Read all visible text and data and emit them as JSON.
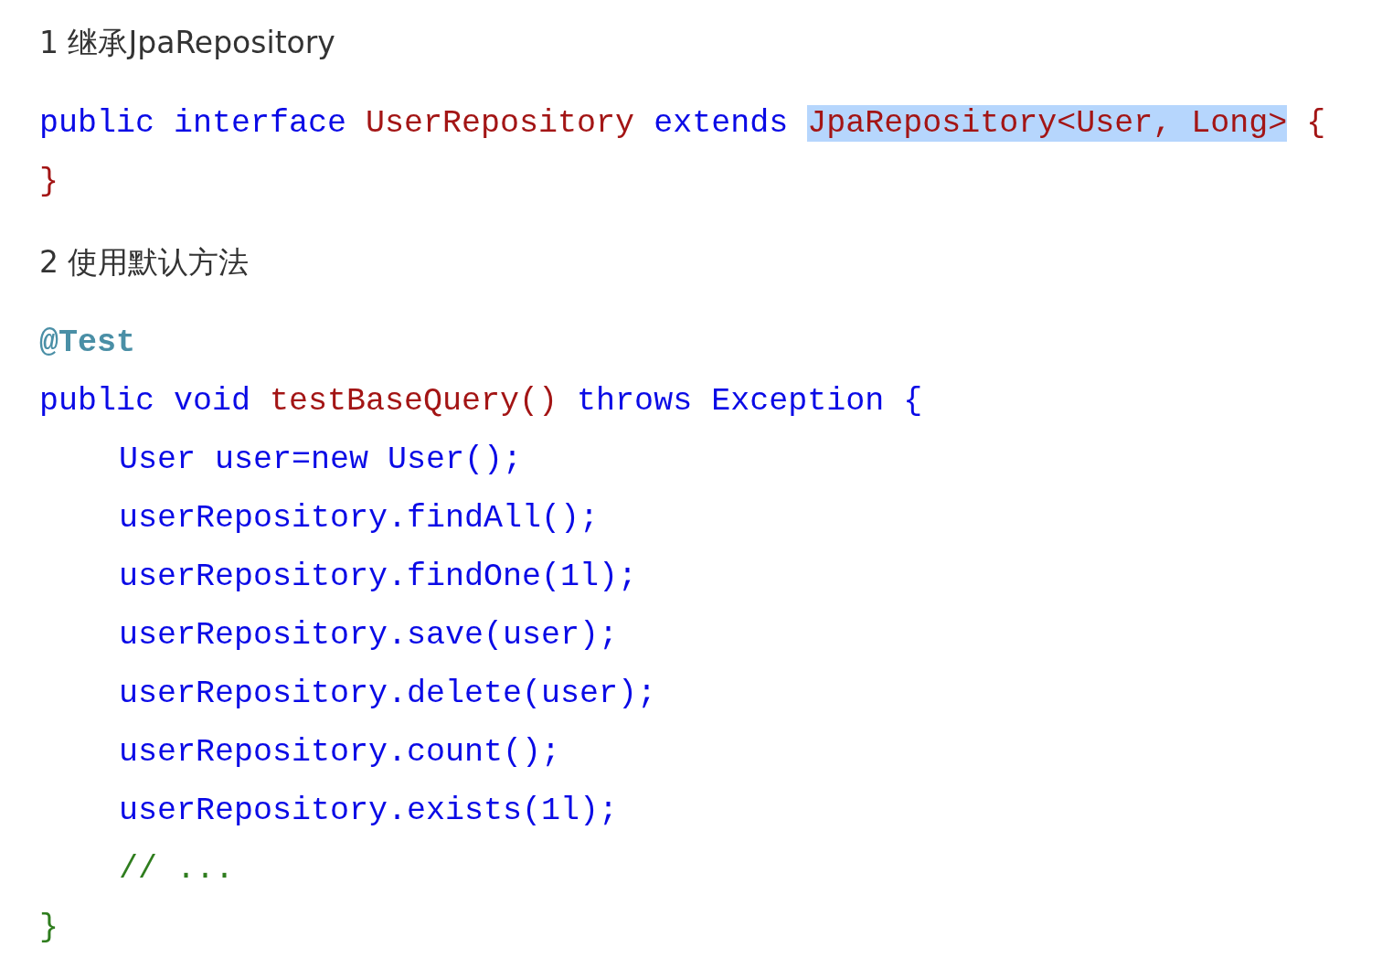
{
  "blocks": [
    {
      "kind": "heading",
      "text": "1 继承JpaRepository"
    },
    {
      "kind": "code",
      "lines": [
        {
          "tokens": [
            {
              "kind": "keyword",
              "text": "public interface "
            },
            {
              "kind": "title",
              "text": "UserRepository"
            },
            {
              "kind": "keyword",
              "text": " extends "
            },
            {
              "kind": "title",
              "text": "JpaRepository<User, Long>",
              "highlighted": true
            },
            {
              "kind": "title",
              "text": " {"
            }
          ]
        },
        {
          "tokens": [
            {
              "kind": "title",
              "text": "}"
            }
          ]
        }
      ]
    },
    {
      "kind": "heading",
      "text": "2 使用默认方法"
    },
    {
      "kind": "code",
      "lines": [
        {
          "tokens": [
            {
              "kind": "annotation",
              "text": "@Test"
            }
          ]
        },
        {
          "tokens": [
            {
              "kind": "keyword",
              "text": "public void "
            },
            {
              "kind": "title",
              "text": "testBaseQuery()"
            },
            {
              "kind": "keyword",
              "text": " throws Exception {"
            }
          ],
          "children": [
            {
              "tokens": [
                {
                  "kind": "keyword",
                  "text": "User user=new User();"
                }
              ]
            },
            {
              "tokens": [
                {
                  "kind": "keyword",
                  "text": "userRepository.findAll();"
                }
              ]
            },
            {
              "tokens": [
                {
                  "kind": "keyword",
                  "text": "userRepository.findOne(1l);"
                }
              ]
            },
            {
              "tokens": [
                {
                  "kind": "keyword",
                  "text": "userRepository.save(user);"
                }
              ]
            },
            {
              "tokens": [
                {
                  "kind": "keyword",
                  "text": "userRepository.delete(user);"
                }
              ]
            },
            {
              "tokens": [
                {
                  "kind": "keyword",
                  "text": "userRepository.count();"
                }
              ]
            },
            {
              "tokens": [
                {
                  "kind": "keyword",
                  "text": "userRepository.exists(1l);"
                }
              ]
            },
            {
              "tokens": [
                {
                  "kind": "comment",
                  "text": "// ..."
                }
              ]
            }
          ]
        },
        {
          "tokens": [
            {
              "kind": "comment",
              "text": "}"
            }
          ]
        }
      ]
    }
  ]
}
